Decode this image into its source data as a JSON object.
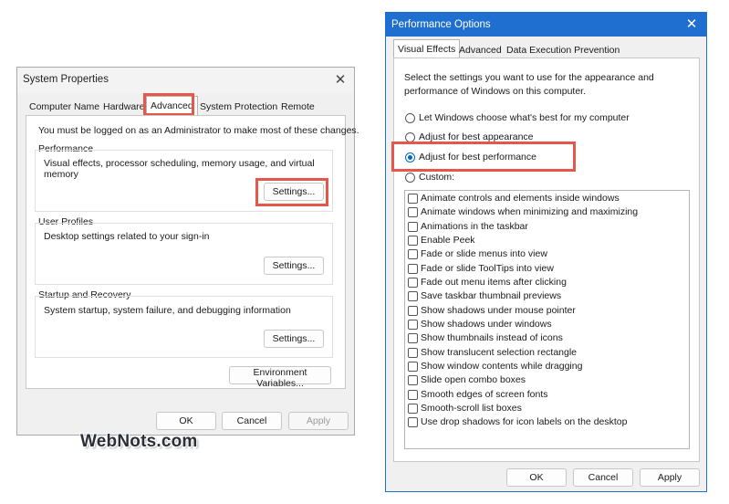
{
  "system_properties": {
    "title": "System Properties",
    "tabs": [
      "Computer Name",
      "Hardware",
      "Advanced",
      "System Protection",
      "Remote"
    ],
    "active_tab": "Advanced",
    "admin_note": "You must be logged on as an Administrator to make most of these changes.",
    "performance": {
      "title": "Performance",
      "description": "Visual effects, processor scheduling, memory usage, and virtual memory",
      "button": "Settings..."
    },
    "user_profiles": {
      "title": "User Profiles",
      "description": "Desktop settings related to your sign-in",
      "button": "Settings..."
    },
    "startup_recovery": {
      "title": "Startup and Recovery",
      "description": "System startup, system failure, and debugging information",
      "button": "Settings..."
    },
    "env_vars_button": "Environment Variables...",
    "ok": "OK",
    "cancel": "Cancel",
    "apply": "Apply"
  },
  "performance_options": {
    "title": "Performance Options",
    "tabs": [
      "Visual Effects",
      "Advanced",
      "Data Execution Prevention"
    ],
    "active_tab": "Visual Effects",
    "intro": "Select the settings you want to use for the appearance and performance of Windows on this computer.",
    "radios": [
      {
        "label": "Let Windows choose what's best for my computer",
        "selected": false
      },
      {
        "label": "Adjust for best appearance",
        "selected": false
      },
      {
        "label": "Adjust for best performance",
        "selected": true
      },
      {
        "label": "Custom:",
        "selected": false
      }
    ],
    "checkboxes": [
      "Animate controls and elements inside windows",
      "Animate windows when minimizing and maximizing",
      "Animations in the taskbar",
      "Enable Peek",
      "Fade or slide menus into view",
      "Fade or slide ToolTips into view",
      "Fade out menu items after clicking",
      "Save taskbar thumbnail previews",
      "Show shadows under mouse pointer",
      "Show shadows under windows",
      "Show thumbnails instead of icons",
      "Show translucent selection rectangle",
      "Show window contents while dragging",
      "Slide open combo boxes",
      "Smooth edges of screen fonts",
      "Smooth-scroll list boxes",
      "Use drop shadows for icon labels on the desktop"
    ],
    "ok": "OK",
    "cancel": "Cancel",
    "apply": "Apply"
  },
  "watermark": "WebNots.com",
  "colors": {
    "highlight": "#e5574a",
    "title_blue": "#1f6fd1",
    "radio_accent": "#0067c0"
  }
}
